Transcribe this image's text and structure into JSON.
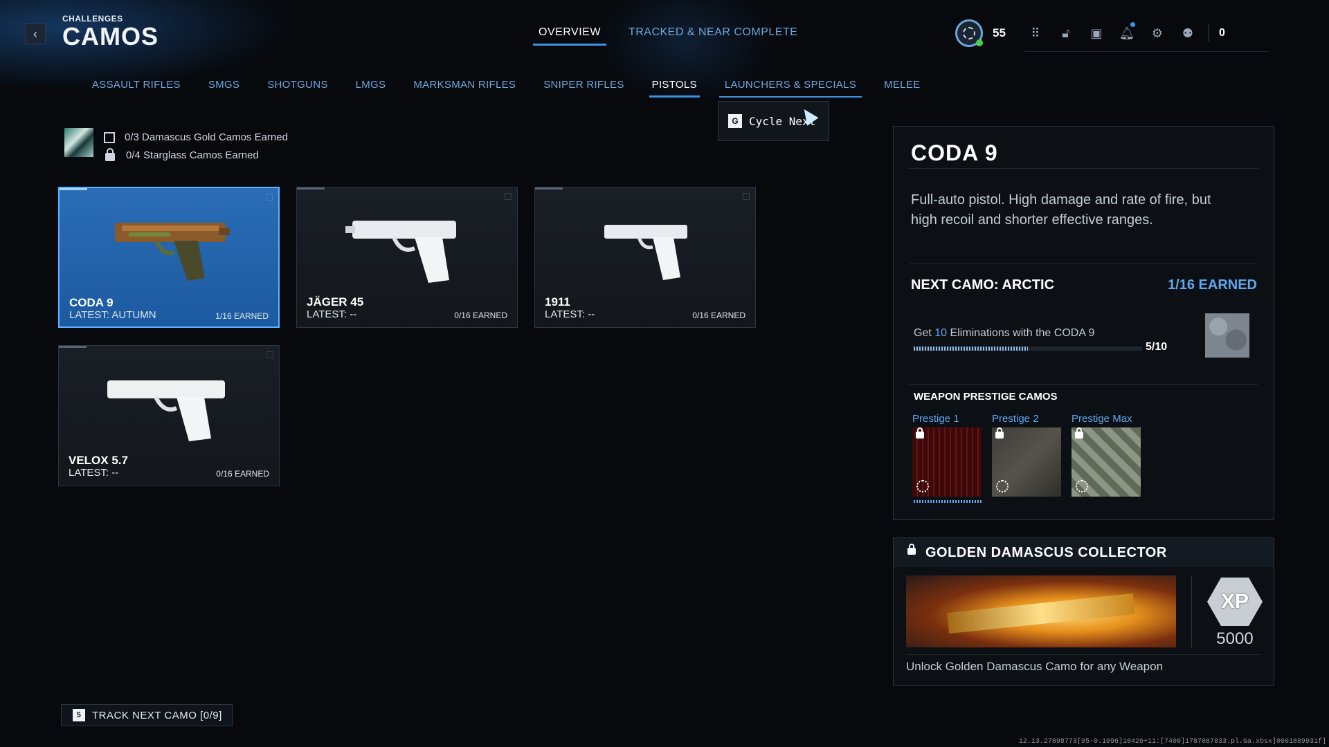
{
  "header": {
    "section": "CHALLENGES",
    "title": "CAMOS",
    "back_icon": "chevron-left-icon"
  },
  "top_tabs": [
    {
      "label": "OVERVIEW",
      "active": true
    },
    {
      "label": "TRACKED & NEAR COMPLETE",
      "active": false
    }
  ],
  "hud": {
    "level": "55",
    "currency": "0",
    "icons": [
      "rank-emblem-icon",
      "grid-menu-icon",
      "unlock-icon",
      "camera-icon",
      "bell-icon",
      "gear-icon",
      "party-icon"
    ]
  },
  "categories": [
    {
      "label": "ASSAULT RIFLES",
      "state": ""
    },
    {
      "label": "SMGS",
      "state": ""
    },
    {
      "label": "SHOTGUNS",
      "state": ""
    },
    {
      "label": "LMGS",
      "state": ""
    },
    {
      "label": "MARKSMAN RIFLES",
      "state": ""
    },
    {
      "label": "SNIPER RIFLES",
      "state": ""
    },
    {
      "label": "PISTOLS",
      "state": "active"
    },
    {
      "label": "LAUNCHERS & SPECIALS",
      "state": "hover"
    },
    {
      "label": "MELEE",
      "state": ""
    }
  ],
  "tooltip": {
    "key": "G",
    "label": "Cycle Next"
  },
  "summary": {
    "damascus": "0/3 Damascus Gold Camos Earned",
    "starglass": "0/4 Starglass Camos Earned"
  },
  "weapons": [
    {
      "name": "CODA 9",
      "latest": "LATEST: AUTUMN",
      "earned": "1/16 EARNED",
      "selected": true
    },
    {
      "name": "JÄGER 45",
      "latest": "LATEST: --",
      "earned": "0/16 EARNED",
      "selected": false
    },
    {
      "name": "1911",
      "latest": "LATEST: --",
      "earned": "0/16 EARNED",
      "selected": false
    },
    {
      "name": "VELOX 5.7",
      "latest": "LATEST: --",
      "earned": "0/16 EARNED",
      "selected": false
    }
  ],
  "detail": {
    "name": "CODA 9",
    "description": "Full-auto pistol. High damage and rate of fire, but high recoil and shorter effective ranges.",
    "next_camo": "NEXT CAMO: ARCTIC",
    "next_earned": "1/16 EARNED",
    "challenge_pre": "Get ",
    "challenge_num": "10",
    "challenge_post": " Eliminations with the CODA 9",
    "progress_text": "5/10",
    "progress": 0.5,
    "prestige_heading": "WEAPON PRESTIGE CAMOS",
    "prestige": [
      "Prestige 1",
      "Prestige 2",
      "Prestige Max"
    ]
  },
  "reward": {
    "title": "GOLDEN DAMASCUS COLLECTOR",
    "xp_label": "XP",
    "xp": "5000",
    "description": "Unlock Golden Damascus Camo for any Weapon"
  },
  "track": {
    "key": "5",
    "label": "TRACK NEXT CAMO [0/9]"
  },
  "build": "12.13.27898773[95-0.1096]10426+11:[7400]1787087833.pl.Ga.xbsx]0001889931f]"
}
